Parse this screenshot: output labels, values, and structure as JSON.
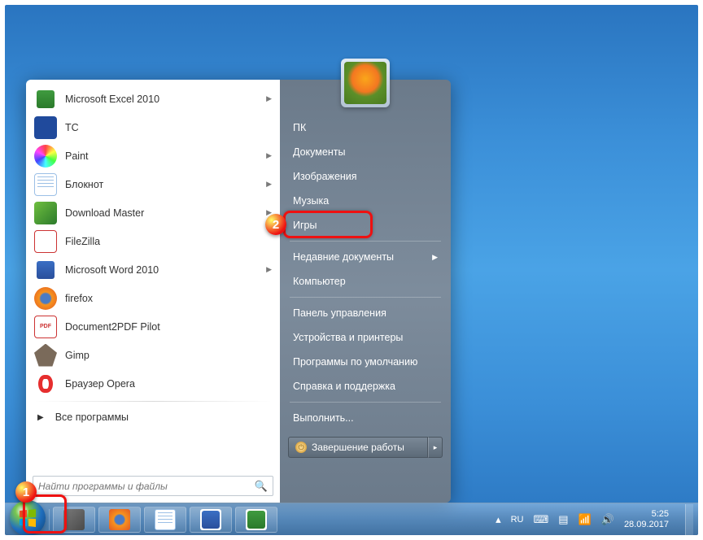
{
  "start_menu": {
    "programs": [
      {
        "name": "Microsoft Excel 2010",
        "arrow": true,
        "icon": "ic-excel"
      },
      {
        "name": "TC",
        "arrow": false,
        "icon": "ic-tc"
      },
      {
        "name": "Paint",
        "arrow": true,
        "icon": "ic-paint"
      },
      {
        "name": "Блокнот",
        "arrow": true,
        "icon": "ic-notepad"
      },
      {
        "name": "Download Master",
        "arrow": true,
        "icon": "ic-dm"
      },
      {
        "name": "FileZilla",
        "arrow": false,
        "icon": "ic-fz"
      },
      {
        "name": "Microsoft Word 2010",
        "arrow": true,
        "icon": "ic-word"
      },
      {
        "name": "firefox",
        "arrow": false,
        "icon": "ic-ff"
      },
      {
        "name": "Document2PDF Pilot",
        "arrow": false,
        "icon": "ic-pdf"
      },
      {
        "name": "Gimp",
        "arrow": false,
        "icon": "ic-gimp"
      },
      {
        "name": "Браузер Opera",
        "arrow": false,
        "icon": "ic-opera"
      }
    ],
    "all_programs": "Все программы",
    "search_placeholder": "Найти программы и файлы",
    "right_items": [
      {
        "label": "ПК",
        "arrow": false,
        "sep": false
      },
      {
        "label": "Документы",
        "arrow": false,
        "sep": false
      },
      {
        "label": "Изображения",
        "arrow": false,
        "sep": false
      },
      {
        "label": "Музыка",
        "arrow": false,
        "sep": false
      },
      {
        "label": "Игры",
        "arrow": false,
        "sep": true
      },
      {
        "label": "Недавние документы",
        "arrow": true,
        "sep": false
      },
      {
        "label": "Компьютер",
        "arrow": false,
        "sep": true,
        "highlight": true
      },
      {
        "label": "Панель управления",
        "arrow": false,
        "sep": false
      },
      {
        "label": "Устройства и принтеры",
        "arrow": false,
        "sep": false
      },
      {
        "label": "Программы по умолчанию",
        "arrow": false,
        "sep": false
      },
      {
        "label": "Справка и поддержка",
        "arrow": false,
        "sep": true
      },
      {
        "label": "Выполнить...",
        "arrow": false,
        "sep": false
      }
    ],
    "shutdown": "Завершение работы"
  },
  "taskbar": {
    "pinned": [
      {
        "id": "foxit",
        "icon": "ic-fox"
      },
      {
        "id": "firefox",
        "icon": "ic-ff"
      },
      {
        "id": "notepad",
        "icon": "ic-notepad"
      },
      {
        "id": "word",
        "icon": "ic-word"
      },
      {
        "id": "excel",
        "icon": "ic-excel"
      }
    ],
    "tray": {
      "lang": "RU",
      "time": "5:25",
      "date": "28.09.2017"
    }
  },
  "callouts": {
    "1": "1",
    "2": "2"
  }
}
